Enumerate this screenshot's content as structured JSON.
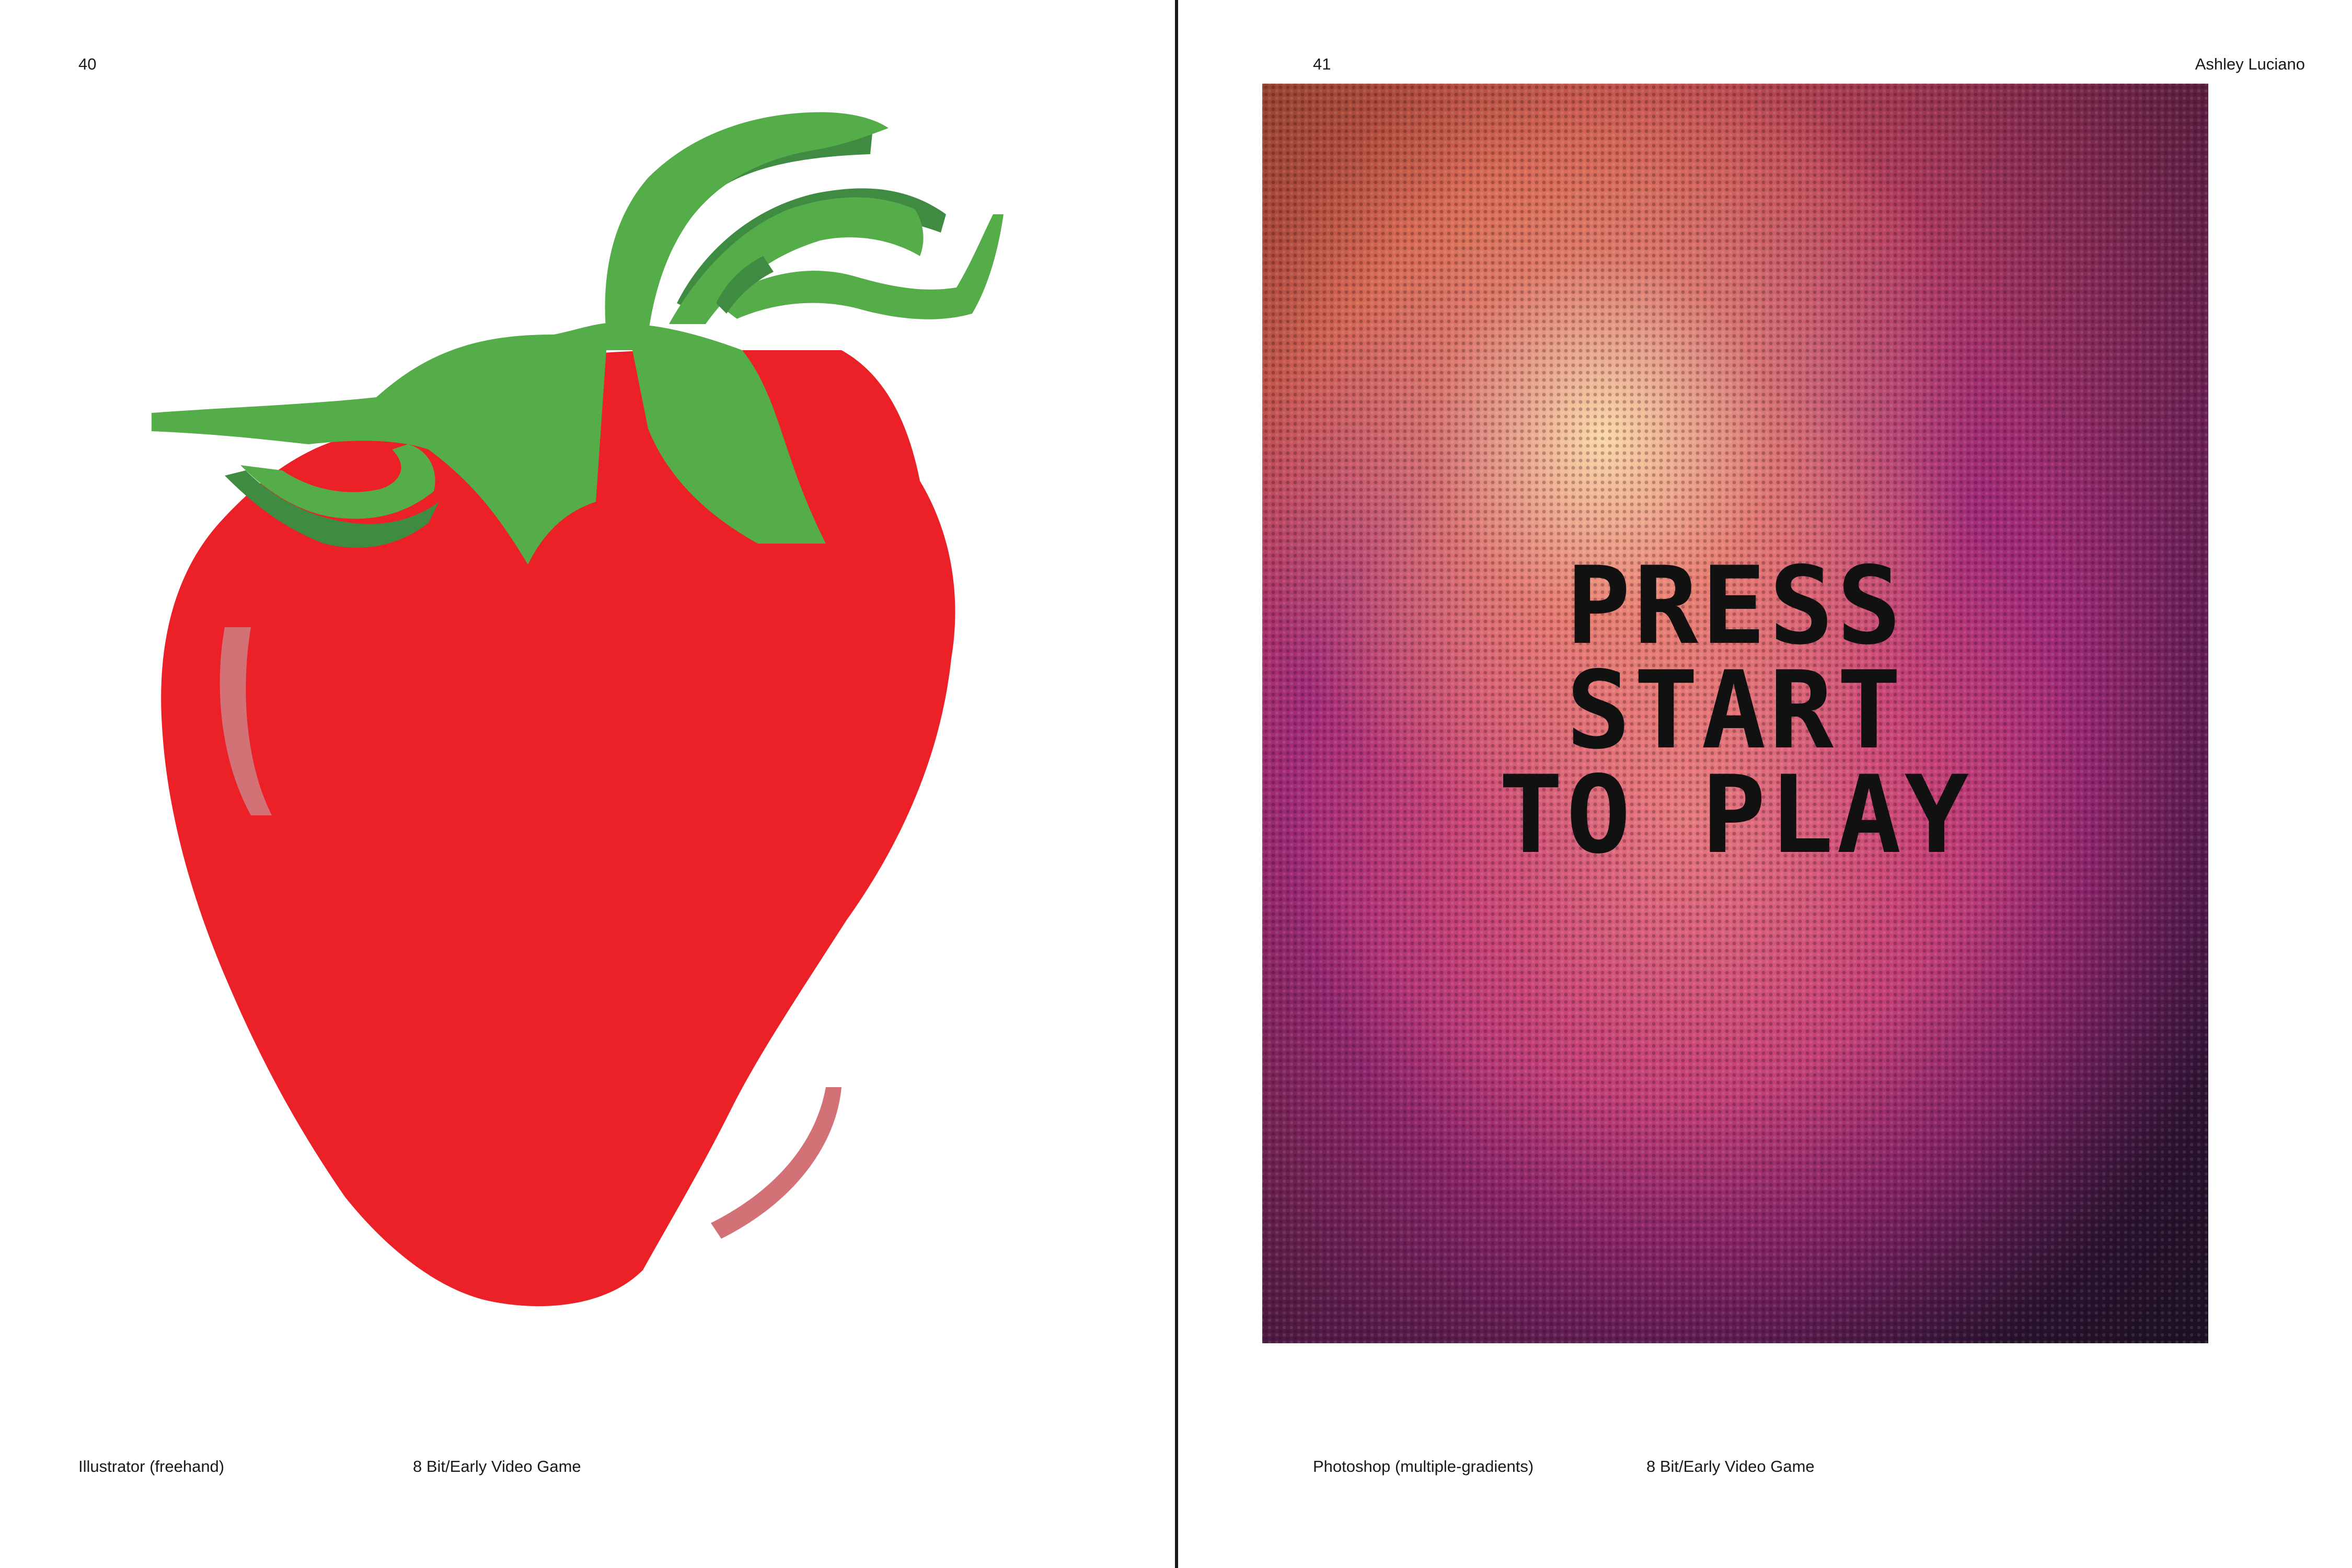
{
  "left_page": {
    "page_number": "40",
    "caption_tool": "Illustrator (freehand)",
    "caption_theme": "8 Bit/Early Video Game",
    "artwork": {
      "subject": "strawberry",
      "colors": {
        "fruit": "#ec2127",
        "leaf": "#55ad4a",
        "leaf_shadow": "#3f8b42",
        "highlight": "#d27277"
      }
    }
  },
  "right_page": {
    "page_number": "41",
    "author": "Ashley Luciano",
    "caption_tool": "Photoshop (multiple-gradients)",
    "caption_theme": "8 Bit/Early Video Game",
    "poster": {
      "lines": [
        "PRESS",
        "START",
        "TO PLAY"
      ],
      "colors": {
        "text": "#111111",
        "glow": "#ffe1aa",
        "magenta": "#c94476",
        "dark": "#251828"
      }
    }
  }
}
